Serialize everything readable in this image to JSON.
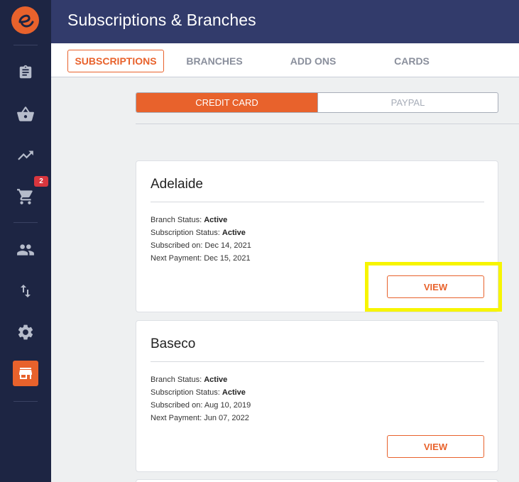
{
  "header": {
    "title": "Subscriptions & Branches"
  },
  "tabs": [
    {
      "label": "SUBSCRIPTIONS",
      "active": true
    },
    {
      "label": "BRANCHES",
      "active": false
    },
    {
      "label": "ADD ONS",
      "active": false
    },
    {
      "label": "CARDS",
      "active": false
    }
  ],
  "payment_toggle": {
    "credit_card": "CREDIT CARD",
    "paypal": "PAYPAL"
  },
  "sidebar": {
    "cart_badge": "2",
    "icons": [
      "logo-icon",
      "clipboard-icon",
      "basket-icon",
      "trending-up-icon",
      "cart-icon",
      "people-icon",
      "swap-vertical-icon",
      "gear-icon",
      "store-icon"
    ]
  },
  "cards": [
    {
      "name": "Adelaide",
      "branch_status_label": "Branch Status:",
      "branch_status": "Active",
      "subscription_status_label": "Subscription Status:",
      "subscription_status": "Active",
      "subscribed_on": "Subscribed on: Dec 14, 2021",
      "next_payment": "Next Payment: Dec 15, 2021",
      "button": "VIEW"
    },
    {
      "name": "Baseco",
      "branch_status_label": "Branch Status:",
      "branch_status": "Active",
      "subscription_status_label": "Subscription Status:",
      "subscription_status": "Active",
      "subscribed_on": "Subscribed on: Aug 10, 2019",
      "next_payment": "Next Payment: Jun 07, 2022",
      "button": "VIEW"
    }
  ],
  "colors": {
    "accent": "#e8622c",
    "sidebar": "#1d2543",
    "header": "#323b6b",
    "highlight": "#f7f500"
  }
}
